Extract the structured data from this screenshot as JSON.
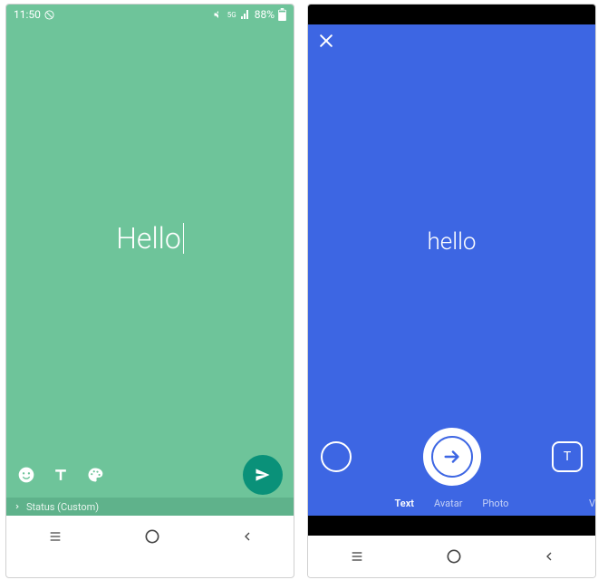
{
  "left": {
    "status_time": "11:50",
    "status_battery": "88%",
    "main_text": "Hello",
    "status_strip": "Status (Custom)"
  },
  "right": {
    "main_text": "hello",
    "t_glyph": "T",
    "tabs": {
      "text": "Text",
      "avatar": "Avatar",
      "photo": "Photo",
      "v": "V"
    }
  }
}
